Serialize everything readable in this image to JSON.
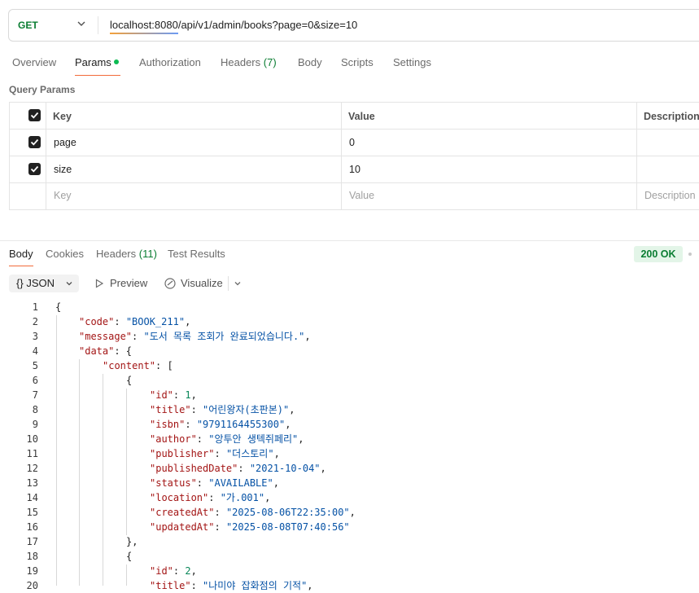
{
  "request": {
    "method": "GET",
    "url": "localhost:8080/api/v1/admin/books?page=0&size=10"
  },
  "tabs": [
    {
      "label": "Overview"
    },
    {
      "label": "Params"
    },
    {
      "label": "Authorization"
    },
    {
      "label": "Headers",
      "count": "(7)"
    },
    {
      "label": "Body"
    },
    {
      "label": "Scripts"
    },
    {
      "label": "Settings"
    }
  ],
  "query_params": {
    "title": "Query Params",
    "headers": {
      "key": "Key",
      "value": "Value",
      "description": "Description"
    },
    "rows": [
      {
        "checked": true,
        "key": "page",
        "value": "0"
      },
      {
        "checked": true,
        "key": "size",
        "value": "10"
      }
    ],
    "placeholder": {
      "key": "Key",
      "value": "Value",
      "description": "Description"
    }
  },
  "response": {
    "tabs": [
      {
        "label": "Body"
      },
      {
        "label": "Cookies"
      },
      {
        "label": "Headers",
        "count": "(11)"
      },
      {
        "label": "Test Results"
      }
    ],
    "status": "200 OK",
    "format": "JSON",
    "format_icon": "{}",
    "preview_label": "Preview",
    "visualize_label": "Visualize"
  },
  "code_lines": [
    [
      {
        "t": "{",
        "c": "p"
      }
    ],
    [
      {
        "t": "\"code\"",
        "c": "k"
      },
      {
        "t": ": ",
        "c": "p"
      },
      {
        "t": "\"BOOK_211\"",
        "c": "s"
      },
      {
        "t": ",",
        "c": "p"
      }
    ],
    [
      {
        "t": "\"message\"",
        "c": "k"
      },
      {
        "t": ": ",
        "c": "p"
      },
      {
        "t": "\"도서 목록 조회가 완료되었습니다.\"",
        "c": "s"
      },
      {
        "t": ",",
        "c": "p"
      }
    ],
    [
      {
        "t": "\"data\"",
        "c": "k"
      },
      {
        "t": ": {",
        "c": "p"
      }
    ],
    [
      {
        "t": "\"content\"",
        "c": "k"
      },
      {
        "t": ": [",
        "c": "p"
      }
    ],
    [
      {
        "t": "{",
        "c": "p"
      }
    ],
    [
      {
        "t": "\"id\"",
        "c": "k"
      },
      {
        "t": ": ",
        "c": "p"
      },
      {
        "t": "1",
        "c": "n"
      },
      {
        "t": ",",
        "c": "p"
      }
    ],
    [
      {
        "t": "\"title\"",
        "c": "k"
      },
      {
        "t": ": ",
        "c": "p"
      },
      {
        "t": "\"어린왕자(초판본)\"",
        "c": "s"
      },
      {
        "t": ",",
        "c": "p"
      }
    ],
    [
      {
        "t": "\"isbn\"",
        "c": "k"
      },
      {
        "t": ": ",
        "c": "p"
      },
      {
        "t": "\"9791164455300\"",
        "c": "s"
      },
      {
        "t": ",",
        "c": "p"
      }
    ],
    [
      {
        "t": "\"author\"",
        "c": "k"
      },
      {
        "t": ": ",
        "c": "p"
      },
      {
        "t": "\"앙투안 생텍쥐페리\"",
        "c": "s"
      },
      {
        "t": ",",
        "c": "p"
      }
    ],
    [
      {
        "t": "\"publisher\"",
        "c": "k"
      },
      {
        "t": ": ",
        "c": "p"
      },
      {
        "t": "\"더스토리\"",
        "c": "s"
      },
      {
        "t": ",",
        "c": "p"
      }
    ],
    [
      {
        "t": "\"publishedDate\"",
        "c": "k"
      },
      {
        "t": ": ",
        "c": "p"
      },
      {
        "t": "\"2021-10-04\"",
        "c": "s"
      },
      {
        "t": ",",
        "c": "p"
      }
    ],
    [
      {
        "t": "\"status\"",
        "c": "k"
      },
      {
        "t": ": ",
        "c": "p"
      },
      {
        "t": "\"AVAILABLE\"",
        "c": "s"
      },
      {
        "t": ",",
        "c": "p"
      }
    ],
    [
      {
        "t": "\"location\"",
        "c": "k"
      },
      {
        "t": ": ",
        "c": "p"
      },
      {
        "t": "\"가.001\"",
        "c": "s"
      },
      {
        "t": ",",
        "c": "p"
      }
    ],
    [
      {
        "t": "\"createdAt\"",
        "c": "k"
      },
      {
        "t": ": ",
        "c": "p"
      },
      {
        "t": "\"2025-08-06T22:35:00\"",
        "c": "s"
      },
      {
        "t": ",",
        "c": "p"
      }
    ],
    [
      {
        "t": "\"updatedAt\"",
        "c": "k"
      },
      {
        "t": ": ",
        "c": "p"
      },
      {
        "t": "\"2025-08-08T07:40:56\"",
        "c": "s"
      }
    ],
    [
      {
        "t": "},",
        "c": "p"
      }
    ],
    [
      {
        "t": "{",
        "c": "p"
      }
    ],
    [
      {
        "t": "\"id\"",
        "c": "k"
      },
      {
        "t": ": ",
        "c": "p"
      },
      {
        "t": "2",
        "c": "n"
      },
      {
        "t": ",",
        "c": "p"
      }
    ],
    [
      {
        "t": "\"title\"",
        "c": "k"
      },
      {
        "t": ": ",
        "c": "p"
      },
      {
        "t": "\"나미야 잡화점의 기적\"",
        "c": "s"
      },
      {
        "t": ",",
        "c": "p"
      }
    ]
  ]
}
